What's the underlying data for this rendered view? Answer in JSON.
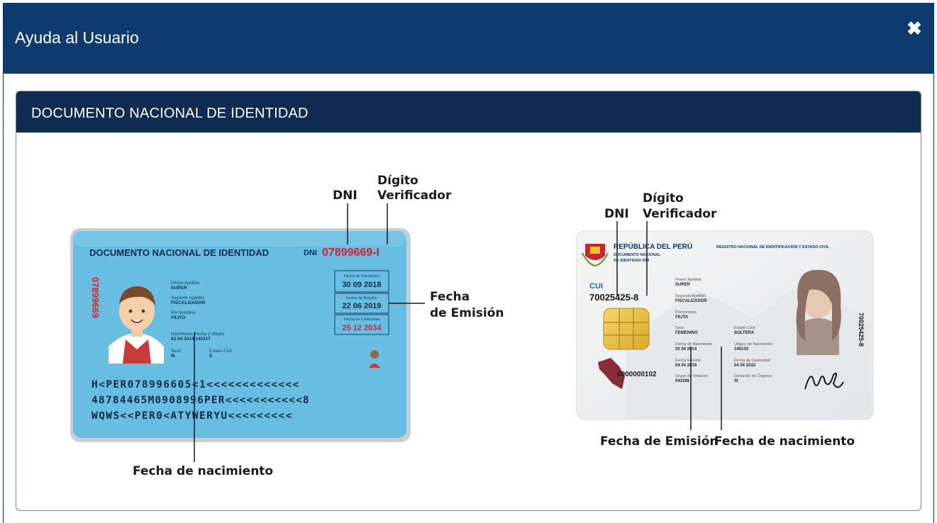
{
  "modal": {
    "title": "Ayuda al Usuario",
    "close_icon": "close-icon",
    "header_color": "#0d3b6f"
  },
  "panel": {
    "title": "DOCUMENTO NACIONAL DE IDENTIDAD",
    "header_color": "#102b52"
  },
  "old_dni": {
    "labels": {
      "dni": "DNI",
      "digito_line1": "Dígito",
      "digito_line2": "Verificador",
      "fecha_emision_line1": "Fecha",
      "fecha_emision_line2": "de Emisión",
      "fecha_nacimiento": "Fecha de nacimiento"
    },
    "card": {
      "header": "DOCUMENTO NACIONAL DE IDENTIDAD",
      "dni_prefix": "DNI",
      "dni_number": "07899669-I",
      "side_number": "07899669",
      "primer_apellido_label": "Primer Apellido",
      "primer_apellido": "SUPER",
      "segundo_apellido_label": "Segundo Apellido",
      "segundo_apellido": "FISCALIZADOR",
      "pre_nombres_label": "Pre Nombres",
      "pre_nombres": "FILITO",
      "nacimiento_label": "Nacimiento: Fecha y Ubigeo",
      "nacimiento": "02 04 2014    140117",
      "sexo_label": "Sexo",
      "sexo": "M",
      "estado_civil_label": "Estado Civil",
      "estado_civil": "S",
      "inscripcion_label": "Fecha de Inscripción",
      "inscripcion": "30 09 2018",
      "emision_label": "Fecha de Emisión",
      "emision": "22 06 2019",
      "caducidad_label": "Fecha de Caducidad",
      "caducidad": "25 12 2034",
      "mrz1": "H<PER078996605<1<<<<<<<<<<<<<",
      "mrz2": "48784465M0908996PER<<<<<<<<<<<8",
      "mrz3": "WQWS<<PER0<ATYWERYU<<<<<<<<<"
    }
  },
  "new_dni": {
    "labels": {
      "dni": "DNI",
      "digito_line1": "Dígito",
      "digito_line2": "Verificador",
      "fecha_emision": "Fecha de Emisión",
      "fecha_nacimiento": "Fecha de nacimiento"
    },
    "card": {
      "country": "REPÚBLICA DEL PERÚ",
      "doc_line1": "DOCUMENTO NACIONAL",
      "doc_line2": "DE IDENTIDAD DNI",
      "registry": "REGISTRO NACIONAL DE IDENTIFICACIÓN Y ESTADO CIVIL",
      "cui_label": "CUI",
      "cui": "70025425-8",
      "primer_apellido_label": "Primer Apellido",
      "primer_apellido": "SUPER",
      "segundo_apellido_label": "Segundo Apellido",
      "segundo_apellido": "FISCALIZADOR",
      "prenombres_label": "Prenombres",
      "prenombres": "FILITA",
      "sexo_label": "Sexo",
      "sexo": "FEMENINO",
      "estado_civil_label": "Estado Civil",
      "estado_civil": "SOLTERA",
      "fecha_nac_label": "Fecha de Nacimiento",
      "fecha_nac": "02 04 2014",
      "ubigeo_label": "Ubigeo de Nacimiento",
      "ubigeo": "140133",
      "fecha_emision_label": "Fecha Emisión",
      "fecha_emision": "04 04 2019",
      "caducidad_label": "Fecha de Caducidad",
      "caducidad": "04 04 2032",
      "grupo_label": "Grupo de Votación",
      "grupo": "041198",
      "donacion_label": "Donación de Órganos",
      "donacion": "SI",
      "serial": "0000000102",
      "side_number": "70025425-8"
    }
  }
}
